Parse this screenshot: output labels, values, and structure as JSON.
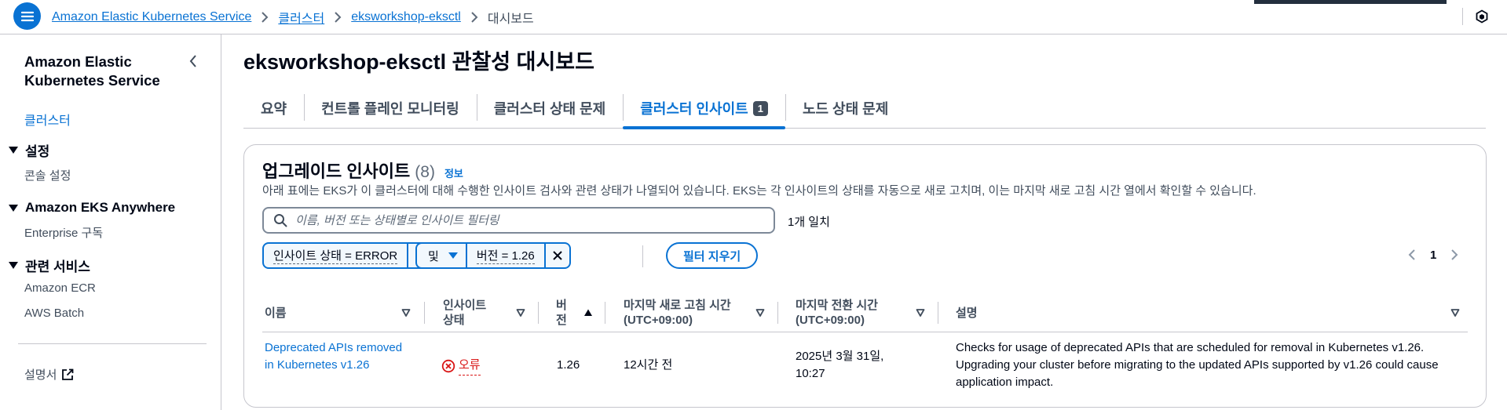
{
  "breadcrumb": {
    "items": [
      "Amazon Elastic Kubernetes Service",
      "클러스터",
      "eksworkshop-eksctl"
    ],
    "current": "대시보드"
  },
  "sidebar": {
    "title": "Amazon Elastic Kubernetes Service",
    "clusters_link": "클러스터",
    "sections": [
      {
        "label": "설정",
        "items": [
          "콘솔 설정"
        ]
      },
      {
        "label": "Amazon EKS Anywhere",
        "items": [
          "Enterprise 구독"
        ]
      },
      {
        "label": "관련 서비스",
        "items": [
          "Amazon ECR",
          "AWS Batch"
        ]
      }
    ],
    "docs_label": "설명서"
  },
  "page": {
    "title": "eksworkshop-eksctl 관찰성 대시보드"
  },
  "tabs": [
    {
      "label": "요약"
    },
    {
      "label": "컨트롤 플레인 모니터링"
    },
    {
      "label": "클러스터 상태 문제"
    },
    {
      "label": "클러스터 인사이트",
      "badge": "1",
      "active": true
    },
    {
      "label": "노드 상태 문제"
    }
  ],
  "insights": {
    "title": "업그레이드 인사이트",
    "count": "(8)",
    "info_label": "정보",
    "description": "아래 표에는 EKS가 이 클러스터에 대해 수행한 인사이트 검사와 관련 상태가 나열되어 있습니다. EKS는 각 인사이트의 상태를 자동으로 새로 고치며, 이는 마지막 새로 고침 시간 열에서 확인할 수 있습니다.",
    "search_placeholder": "이름, 버전 또는 상태별로 인사이트 필터링",
    "match_count": "1개 일치",
    "filter_tokens": {
      "status_token": "인사이트 상태 = ERROR",
      "operator": "및",
      "version_token": "버전 = 1.26"
    },
    "clear_filters": "필터 지우기",
    "page_number": "1",
    "columns": [
      {
        "label": "이름"
      },
      {
        "label": "인사이트 상태"
      },
      {
        "label": "버전"
      },
      {
        "label": "마지막 새로 고침 시간 (UTC+09:00)"
      },
      {
        "label": "마지막 전환 시간 (UTC+09:00)"
      },
      {
        "label": "설명"
      }
    ],
    "rows": [
      {
        "name": "Deprecated APIs removed in Kubernetes v1.26",
        "status": "오류",
        "version": "1.26",
        "last_refresh": "12시간 전",
        "last_transition": "2025년 3월 31일, 10:27",
        "description": "Checks for usage of deprecated APIs that are scheduled for removal in Kubernetes v1.26. Upgrading your cluster before migrating to the updated APIs supported by v1.26 could cause application impact."
      }
    ]
  },
  "colors": {
    "accent": "#0972d3",
    "error": "#d91515",
    "text": "#000716",
    "muted": "#414d5c"
  },
  "icons": [
    "menu-icon",
    "chevron-right-icon",
    "cube-icon",
    "chevron-left-icon",
    "caret-down-icon",
    "external-link-icon",
    "search-icon",
    "close-icon",
    "sort-icon",
    "error-icon"
  ]
}
